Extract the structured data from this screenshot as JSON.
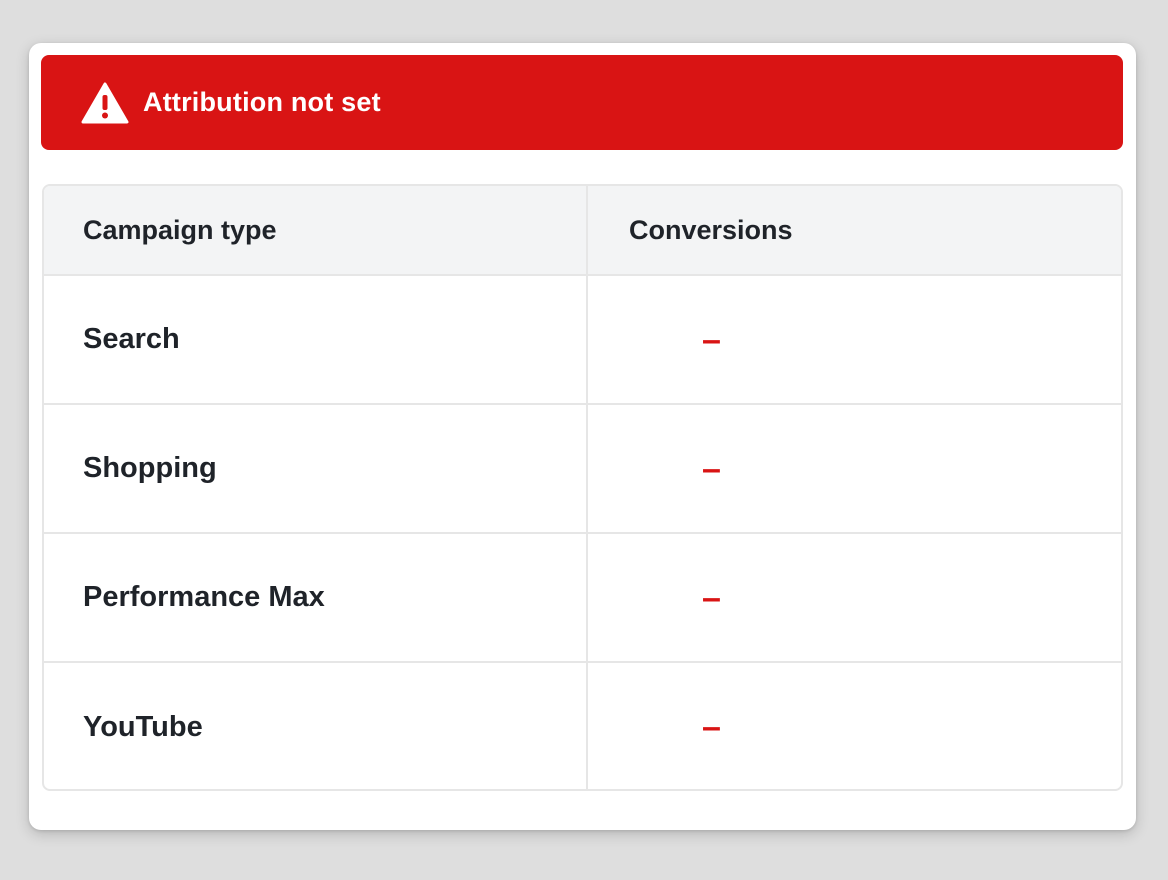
{
  "banner": {
    "icon": "warning-icon",
    "message": "Attribution not set",
    "color": "#d91414"
  },
  "table": {
    "columns": [
      "Campaign type",
      "Conversions"
    ],
    "rows": [
      {
        "campaign_type": "Search",
        "conversions": "–"
      },
      {
        "campaign_type": "Shopping",
        "conversions": "–"
      },
      {
        "campaign_type": "Performance Max",
        "conversions": "–"
      },
      {
        "campaign_type": "YouTube",
        "conversions": "–"
      }
    ]
  }
}
